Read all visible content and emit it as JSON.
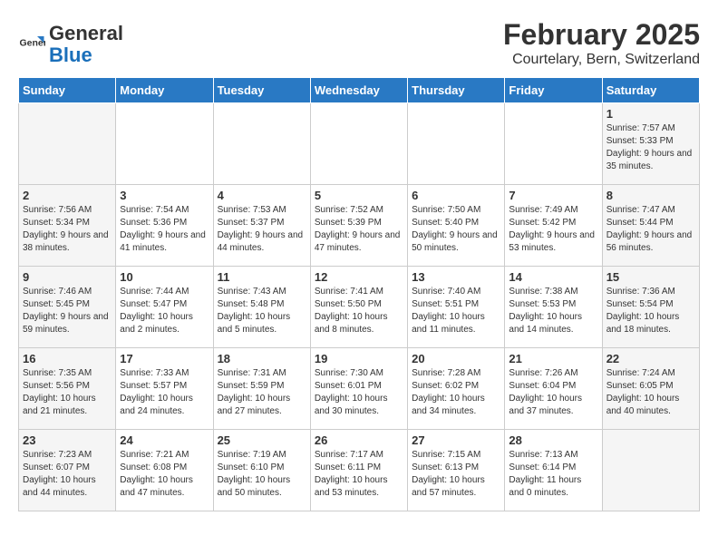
{
  "header": {
    "logo_text_general": "General",
    "logo_text_blue": "Blue",
    "month_year": "February 2025",
    "location": "Courtelary, Bern, Switzerland"
  },
  "weekdays": [
    "Sunday",
    "Monday",
    "Tuesday",
    "Wednesday",
    "Thursday",
    "Friday",
    "Saturday"
  ],
  "weeks": [
    [
      null,
      null,
      null,
      null,
      null,
      null,
      {
        "day": 1,
        "sunrise": "7:57 AM",
        "sunset": "5:33 PM",
        "daylight": "9 hours and 35 minutes."
      }
    ],
    [
      {
        "day": 2,
        "sunrise": "7:56 AM",
        "sunset": "5:34 PM",
        "daylight": "9 hours and 38 minutes."
      },
      {
        "day": 3,
        "sunrise": "7:54 AM",
        "sunset": "5:36 PM",
        "daylight": "9 hours and 41 minutes."
      },
      {
        "day": 4,
        "sunrise": "7:53 AM",
        "sunset": "5:37 PM",
        "daylight": "9 hours and 44 minutes."
      },
      {
        "day": 5,
        "sunrise": "7:52 AM",
        "sunset": "5:39 PM",
        "daylight": "9 hours and 47 minutes."
      },
      {
        "day": 6,
        "sunrise": "7:50 AM",
        "sunset": "5:40 PM",
        "daylight": "9 hours and 50 minutes."
      },
      {
        "day": 7,
        "sunrise": "7:49 AM",
        "sunset": "5:42 PM",
        "daylight": "9 hours and 53 minutes."
      },
      {
        "day": 8,
        "sunrise": "7:47 AM",
        "sunset": "5:44 PM",
        "daylight": "9 hours and 56 minutes."
      }
    ],
    [
      {
        "day": 9,
        "sunrise": "7:46 AM",
        "sunset": "5:45 PM",
        "daylight": "9 hours and 59 minutes."
      },
      {
        "day": 10,
        "sunrise": "7:44 AM",
        "sunset": "5:47 PM",
        "daylight": "10 hours and 2 minutes."
      },
      {
        "day": 11,
        "sunrise": "7:43 AM",
        "sunset": "5:48 PM",
        "daylight": "10 hours and 5 minutes."
      },
      {
        "day": 12,
        "sunrise": "7:41 AM",
        "sunset": "5:50 PM",
        "daylight": "10 hours and 8 minutes."
      },
      {
        "day": 13,
        "sunrise": "7:40 AM",
        "sunset": "5:51 PM",
        "daylight": "10 hours and 11 minutes."
      },
      {
        "day": 14,
        "sunrise": "7:38 AM",
        "sunset": "5:53 PM",
        "daylight": "10 hours and 14 minutes."
      },
      {
        "day": 15,
        "sunrise": "7:36 AM",
        "sunset": "5:54 PM",
        "daylight": "10 hours and 18 minutes."
      }
    ],
    [
      {
        "day": 16,
        "sunrise": "7:35 AM",
        "sunset": "5:56 PM",
        "daylight": "10 hours and 21 minutes."
      },
      {
        "day": 17,
        "sunrise": "7:33 AM",
        "sunset": "5:57 PM",
        "daylight": "10 hours and 24 minutes."
      },
      {
        "day": 18,
        "sunrise": "7:31 AM",
        "sunset": "5:59 PM",
        "daylight": "10 hours and 27 minutes."
      },
      {
        "day": 19,
        "sunrise": "7:30 AM",
        "sunset": "6:01 PM",
        "daylight": "10 hours and 30 minutes."
      },
      {
        "day": 20,
        "sunrise": "7:28 AM",
        "sunset": "6:02 PM",
        "daylight": "10 hours and 34 minutes."
      },
      {
        "day": 21,
        "sunrise": "7:26 AM",
        "sunset": "6:04 PM",
        "daylight": "10 hours and 37 minutes."
      },
      {
        "day": 22,
        "sunrise": "7:24 AM",
        "sunset": "6:05 PM",
        "daylight": "10 hours and 40 minutes."
      }
    ],
    [
      {
        "day": 23,
        "sunrise": "7:23 AM",
        "sunset": "6:07 PM",
        "daylight": "10 hours and 44 minutes."
      },
      {
        "day": 24,
        "sunrise": "7:21 AM",
        "sunset": "6:08 PM",
        "daylight": "10 hours and 47 minutes."
      },
      {
        "day": 25,
        "sunrise": "7:19 AM",
        "sunset": "6:10 PM",
        "daylight": "10 hours and 50 minutes."
      },
      {
        "day": 26,
        "sunrise": "7:17 AM",
        "sunset": "6:11 PM",
        "daylight": "10 hours and 53 minutes."
      },
      {
        "day": 27,
        "sunrise": "7:15 AM",
        "sunset": "6:13 PM",
        "daylight": "10 hours and 57 minutes."
      },
      {
        "day": 28,
        "sunrise": "7:13 AM",
        "sunset": "6:14 PM",
        "daylight": "11 hours and 0 minutes."
      },
      null
    ]
  ]
}
